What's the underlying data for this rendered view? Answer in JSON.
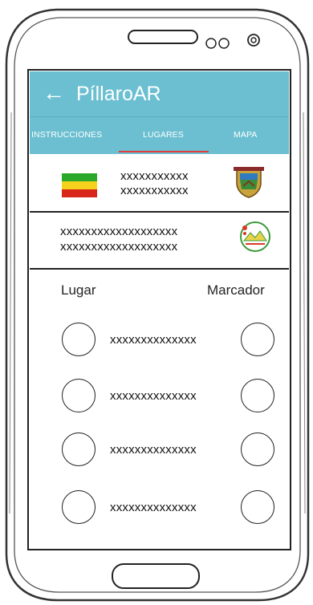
{
  "app": {
    "back_glyph": "←",
    "title": "PíllaroAR"
  },
  "tabs": [
    {
      "label": "INSTRUCCIONES",
      "active": false
    },
    {
      "label": "LUGARES",
      "active": true
    },
    {
      "label": "MAPA",
      "active": false
    }
  ],
  "accent_color": "#6bbfd1",
  "indicator_color": "#e23b3b",
  "card1": {
    "line1": "xxxxxxxxxxx",
    "line2": "xxxxxxxxxxx",
    "flag_icon": "tricolor-flag-icon",
    "emblem_icon": "coat-of-arms-icon"
  },
  "card2": {
    "line1": "xxxxxxxxxxxxxxxxxxx",
    "line2": "xxxxxxxxxxxxxxxxxxx",
    "emblem_icon": "municipal-seal-icon"
  },
  "list": {
    "header_left": "Lugar",
    "header_right": "Marcador",
    "rows": [
      {
        "text": "xxxxxxxxxxxxxx"
      },
      {
        "text": "xxxxxxxxxxxxxx"
      },
      {
        "text": "xxxxxxxxxxxxxx"
      },
      {
        "text": "xxxxxxxxxxxxxx"
      }
    ]
  }
}
